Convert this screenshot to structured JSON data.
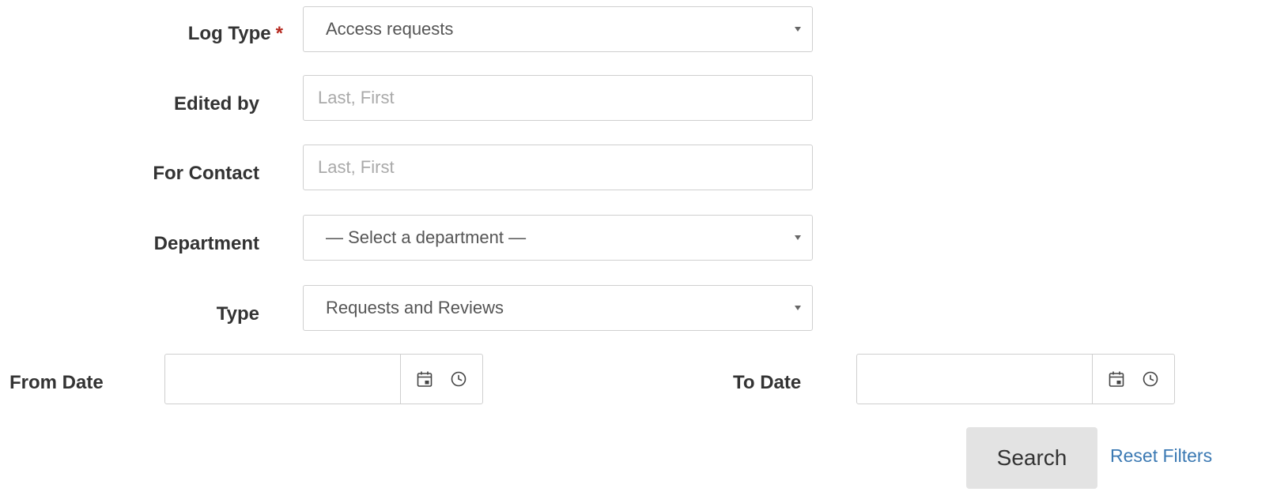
{
  "form": {
    "log_type": {
      "label": "Log Type",
      "required_marker": "*",
      "value": "Access requests"
    },
    "edited_by": {
      "label": "Edited by",
      "placeholder": "Last, First",
      "value": ""
    },
    "for_contact": {
      "label": "For Contact",
      "placeholder": "Last, First",
      "value": ""
    },
    "department": {
      "label": "Department",
      "value": "— Select a department —"
    },
    "type": {
      "label": "Type",
      "value": "Requests and Reviews"
    },
    "from_date": {
      "label": "From Date",
      "value": ""
    },
    "to_date": {
      "label": "To Date",
      "value": ""
    }
  },
  "actions": {
    "search_label": "Search",
    "reset_label": "Reset Filters"
  },
  "icons": {
    "select_caret": "chevron-down-icon",
    "date_picker": "calendar-icon",
    "time_picker": "clock-icon"
  },
  "colors": {
    "required_marker": "#b5281e",
    "link": "#3b79b3",
    "search_button_bg": "#e3e3e3",
    "field_border": "#cfcfcf"
  }
}
